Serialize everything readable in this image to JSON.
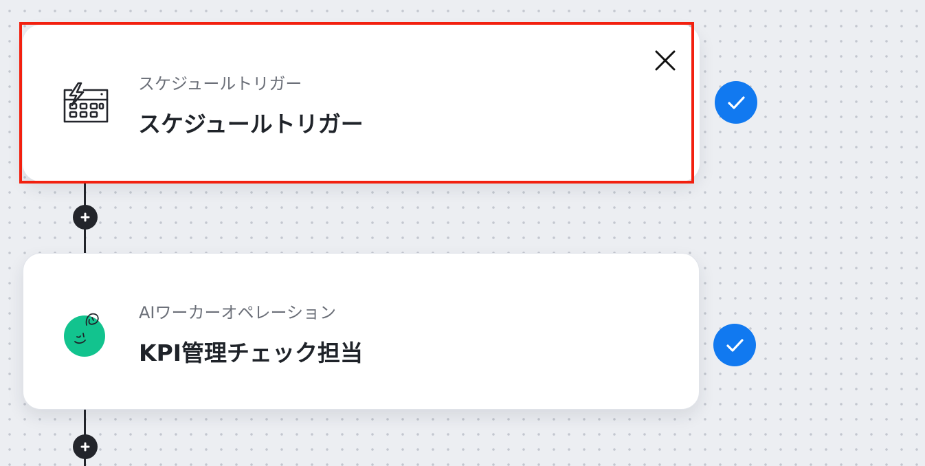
{
  "workflow": {
    "steps": [
      {
        "type_label": "スケジュールトリガー",
        "title": "スケジュールトリガー",
        "icon": "calendar-lightning-icon",
        "status": "completed",
        "selected": true
      },
      {
        "type_label": "AIワーカーオペレーション",
        "title": "KPI管理チェック担当",
        "icon": "ai-worker-avatar-icon",
        "status": "completed",
        "selected": false
      }
    ]
  },
  "colors": {
    "canvas_bg": "#eceef2",
    "canvas_dot": "#c3c7cf",
    "selection_outline": "#f2200f",
    "check_badge": "#1179f0",
    "ai_avatar": "#12c38e",
    "connector": "#23252b"
  }
}
